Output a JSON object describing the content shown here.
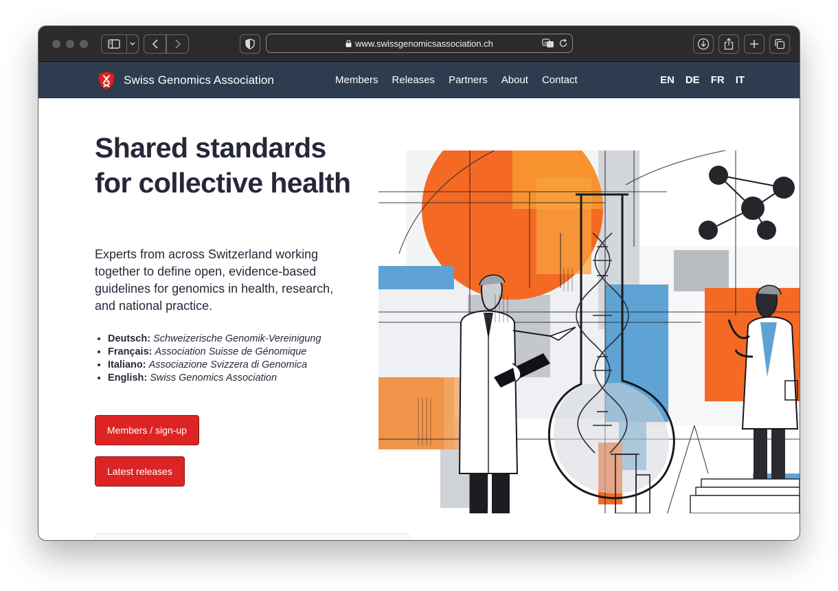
{
  "browser": {
    "url": "www.swissgenomicsassociation.ch"
  },
  "site": {
    "brand": "Swiss Genomics Association",
    "nav": [
      "Members",
      "Releases",
      "Partners",
      "About",
      "Contact"
    ],
    "languages": [
      "EN",
      "DE",
      "FR",
      "IT"
    ]
  },
  "hero": {
    "title": "Shared standards for collective health",
    "lead": "Experts from across Switzerland working together to define open, evidence-based guidelines for genomics in health, research, and national practice.",
    "names": [
      {
        "lang": "Deutsch:",
        "name": "Schweizerische Genomik-Vereinigung"
      },
      {
        "lang": "Français:",
        "name": "Association Suisse de Génomique"
      },
      {
        "lang": "Italiano:",
        "name": "Associazione Svizzera di Genomica"
      },
      {
        "lang": "English:",
        "name": "Swiss Genomics Association"
      }
    ],
    "buttons": {
      "members": "Members / sign-up",
      "releases": "Latest releases"
    }
  },
  "colors": {
    "nav_bg": "#2d3d4f",
    "accent_red": "#dd2424",
    "heading": "#26283a",
    "illustration_orange": "#f46a24",
    "illustration_blue": "#5ea3d3"
  }
}
